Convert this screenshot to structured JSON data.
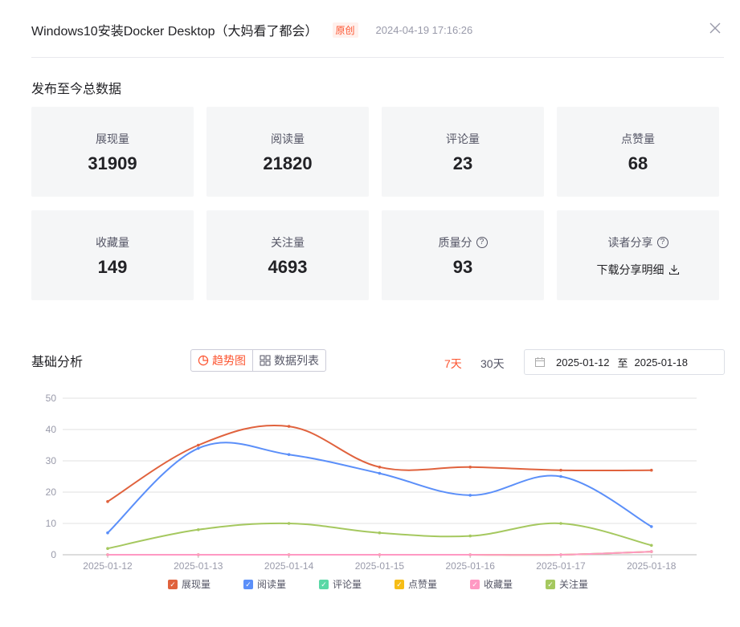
{
  "header": {
    "title": "Windows10安装Docker Desktop（大妈看了都会）",
    "badge": "原创",
    "date": "2024-04-19 17:16:26"
  },
  "overview": {
    "title": "发布至今总数据",
    "stats": [
      {
        "label": "展现量",
        "value": "31909"
      },
      {
        "label": "阅读量",
        "value": "21820"
      },
      {
        "label": "评论量",
        "value": "23"
      },
      {
        "label": "点赞量",
        "value": "68"
      },
      {
        "label": "收藏量",
        "value": "149"
      },
      {
        "label": "关注量",
        "value": "4693"
      },
      {
        "label": "质量分",
        "value": "93"
      },
      {
        "label": "读者分享",
        "link": "下载分享明细"
      }
    ]
  },
  "analysis": {
    "title": "基础分析",
    "tabs": [
      {
        "label": "趋势图",
        "icon": "pie-chart-icon"
      },
      {
        "label": "数据列表",
        "icon": "grid-icon"
      }
    ],
    "ranges": [
      "7天",
      "30天"
    ],
    "date_range": {
      "start": "2025-01-12",
      "separator": "至",
      "end": "2025-01-18"
    }
  },
  "colors": {
    "accent": "#fc5531"
  },
  "chart_data": {
    "type": "line",
    "x": [
      "2025-01-12",
      "2025-01-13",
      "2025-01-14",
      "2025-01-15",
      "2025-01-16",
      "2025-01-17",
      "2025-01-18"
    ],
    "ylim": [
      0,
      50
    ],
    "yticks": [
      "0",
      "10",
      "20",
      "30",
      "40",
      "50"
    ],
    "grid": true,
    "legend_position": "bottom",
    "series": [
      {
        "name": "展现量",
        "color": "#e0623d",
        "values": [
          17,
          35,
          41,
          28,
          28,
          27,
          27
        ]
      },
      {
        "name": "阅读量",
        "color": "#5b8ff9",
        "values": [
          7,
          34,
          32,
          26,
          19,
          25,
          9
        ]
      },
      {
        "name": "评论量",
        "color": "#5ad8a6",
        "values": [
          0,
          0,
          0,
          0,
          0,
          0,
          1
        ]
      },
      {
        "name": "点赞量",
        "color": "#f6bd16",
        "values": [
          0,
          0,
          0,
          0,
          0,
          0,
          1
        ]
      },
      {
        "name": "收藏量",
        "color": "#ff99c3",
        "values": [
          0,
          0,
          0,
          0,
          0,
          0,
          1
        ]
      },
      {
        "name": "关注量",
        "color": "#a5c85f",
        "values": [
          2,
          8,
          10,
          7,
          6,
          10,
          3
        ]
      }
    ]
  }
}
